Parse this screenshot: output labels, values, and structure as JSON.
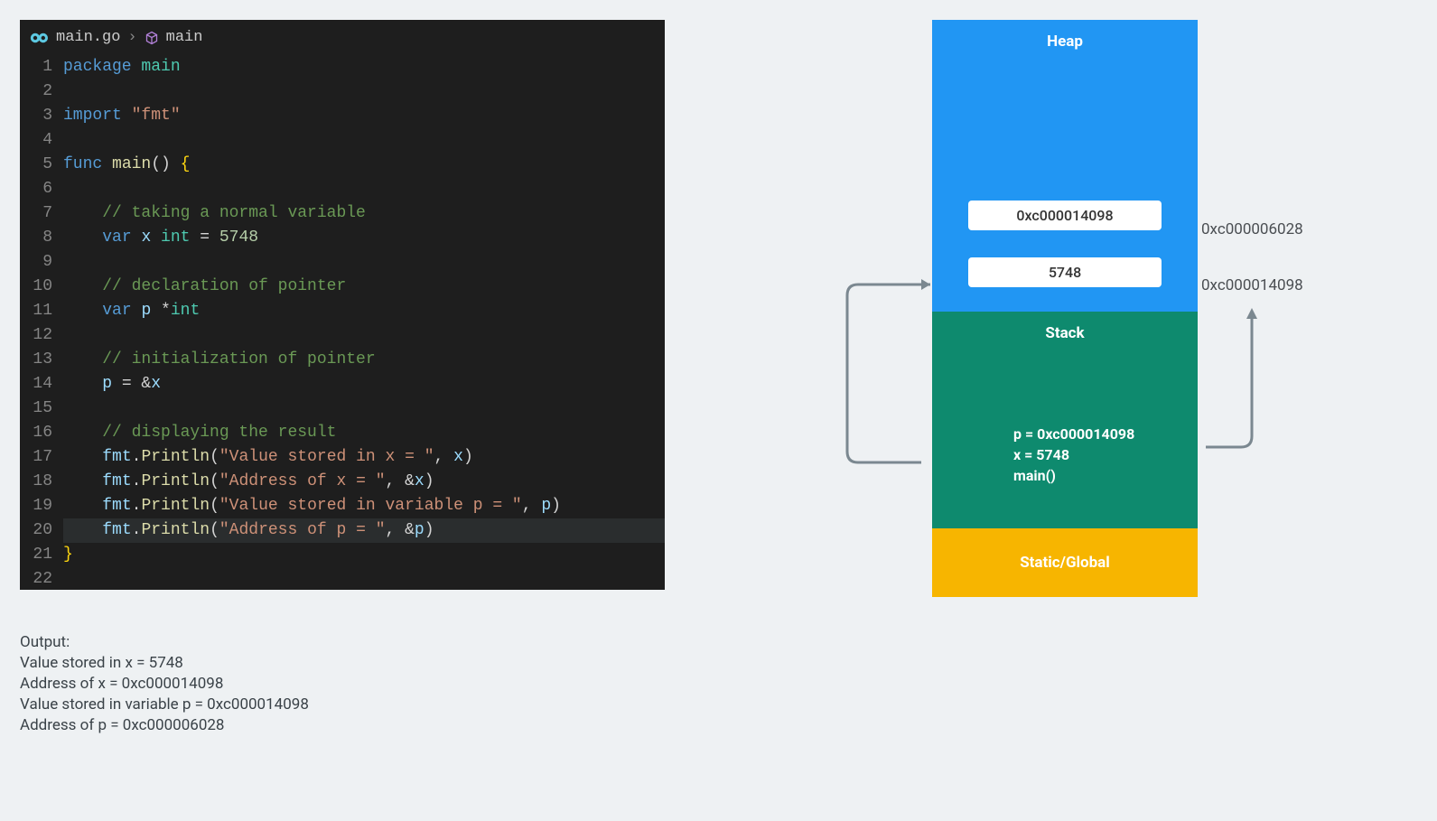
{
  "editor": {
    "file": "main.go",
    "symbol": "main",
    "lines": [
      [
        {
          "t": "package ",
          "c": "kw"
        },
        {
          "t": "main",
          "c": "pkg"
        }
      ],
      [],
      [
        {
          "t": "import ",
          "c": "kw"
        },
        {
          "t": "\"fmt\"",
          "c": "str"
        }
      ],
      [],
      [
        {
          "t": "func ",
          "c": "kw"
        },
        {
          "t": "main",
          "c": "func"
        },
        {
          "t": "() ",
          "c": "op"
        },
        {
          "t": "{",
          "c": "brace"
        }
      ],
      [],
      [
        {
          "t": "    // taking a normal variable",
          "c": "comment"
        }
      ],
      [
        {
          "t": "    ",
          "c": "op"
        },
        {
          "t": "var ",
          "c": "kw"
        },
        {
          "t": "x ",
          "c": "var"
        },
        {
          "t": "int",
          "c": "type"
        },
        {
          "t": " = ",
          "c": "op"
        },
        {
          "t": "5748",
          "c": "num"
        }
      ],
      [],
      [
        {
          "t": "    // declaration of pointer",
          "c": "comment"
        }
      ],
      [
        {
          "t": "    ",
          "c": "op"
        },
        {
          "t": "var ",
          "c": "kw"
        },
        {
          "t": "p ",
          "c": "var"
        },
        {
          "t": "*",
          "c": "op"
        },
        {
          "t": "int",
          "c": "type"
        }
      ],
      [],
      [
        {
          "t": "    // initialization of pointer",
          "c": "comment"
        }
      ],
      [
        {
          "t": "    ",
          "c": "op"
        },
        {
          "t": "p",
          "c": "var"
        },
        {
          "t": " = &",
          "c": "op"
        },
        {
          "t": "x",
          "c": "var"
        }
      ],
      [],
      [
        {
          "t": "    // displaying the result",
          "c": "comment"
        }
      ],
      [
        {
          "t": "    ",
          "c": "op"
        },
        {
          "t": "fmt",
          "c": "var"
        },
        {
          "t": ".",
          "c": "op"
        },
        {
          "t": "Println",
          "c": "func"
        },
        {
          "t": "(",
          "c": "op"
        },
        {
          "t": "\"Value stored in x = \"",
          "c": "str"
        },
        {
          "t": ", ",
          "c": "op"
        },
        {
          "t": "x",
          "c": "var"
        },
        {
          "t": ")",
          "c": "op"
        }
      ],
      [
        {
          "t": "    ",
          "c": "op"
        },
        {
          "t": "fmt",
          "c": "var"
        },
        {
          "t": ".",
          "c": "op"
        },
        {
          "t": "Println",
          "c": "func"
        },
        {
          "t": "(",
          "c": "op"
        },
        {
          "t": "\"Address of x = \"",
          "c": "str"
        },
        {
          "t": ", &",
          "c": "op"
        },
        {
          "t": "x",
          "c": "var"
        },
        {
          "t": ")",
          "c": "op"
        }
      ],
      [
        {
          "t": "    ",
          "c": "op"
        },
        {
          "t": "fmt",
          "c": "var"
        },
        {
          "t": ".",
          "c": "op"
        },
        {
          "t": "Println",
          "c": "func"
        },
        {
          "t": "(",
          "c": "op"
        },
        {
          "t": "\"Value stored in variable p = \"",
          "c": "str"
        },
        {
          "t": ", ",
          "c": "op"
        },
        {
          "t": "p",
          "c": "var"
        },
        {
          "t": ")",
          "c": "op"
        }
      ],
      [
        {
          "t": "    ",
          "c": "op"
        },
        {
          "t": "fmt",
          "c": "var"
        },
        {
          "t": ".",
          "c": "op"
        },
        {
          "t": "Println",
          "c": "func"
        },
        {
          "t": "(",
          "c": "op"
        },
        {
          "t": "\"Address of p = \"",
          "c": "str"
        },
        {
          "t": ", &",
          "c": "op"
        },
        {
          "t": "p",
          "c": "var"
        },
        {
          "t": ")",
          "c": "op"
        }
      ],
      [
        {
          "t": "}",
          "c": "brace"
        }
      ],
      []
    ]
  },
  "output": {
    "header": "Output:",
    "lines": [
      "Value stored in x =  5748",
      "Address of x =  0xc000014098",
      "Value stored in variable p =  0xc000014098",
      "Address of p =  0xc000006028"
    ]
  },
  "diagram": {
    "heap_title": "Heap",
    "stack_title": "Stack",
    "static_title": "Static/Global",
    "box1_value": "0xc000014098",
    "box1_addr": "0xc000006028",
    "box2_value": "5748",
    "box2_addr": "0xc000014098",
    "stack_var_p": "p = 0xc000014098",
    "stack_var_x": "x = 5748",
    "stack_func": "main()"
  }
}
